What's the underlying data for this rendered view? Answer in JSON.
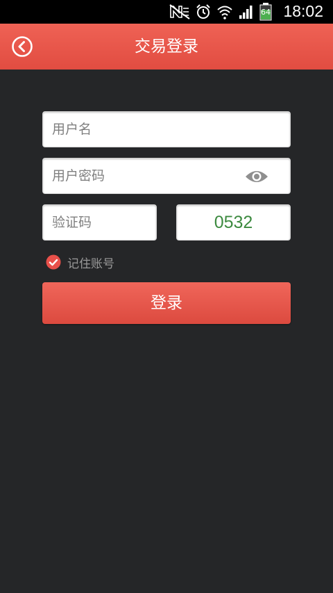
{
  "status_bar": {
    "time": "18:02",
    "battery_level": "64",
    "icons": [
      "no-sim-icon",
      "alarm-icon",
      "wifi-icon",
      "signal-icon",
      "battery-icon"
    ]
  },
  "header": {
    "title": "交易登录",
    "back_icon": "back-arrow-icon"
  },
  "form": {
    "username": {
      "placeholder": "用户名",
      "value": ""
    },
    "password": {
      "placeholder": "用户密码",
      "value": "",
      "toggle_icon": "eye-icon"
    },
    "captcha": {
      "placeholder": "验证码",
      "value": "",
      "code": "0532"
    },
    "remember": {
      "label": "记住账号",
      "checked": true
    },
    "login_label": "登录"
  },
  "colors": {
    "accent": "#e85a4e",
    "background": "#252628",
    "captcha_text": "#3c8a3f"
  }
}
